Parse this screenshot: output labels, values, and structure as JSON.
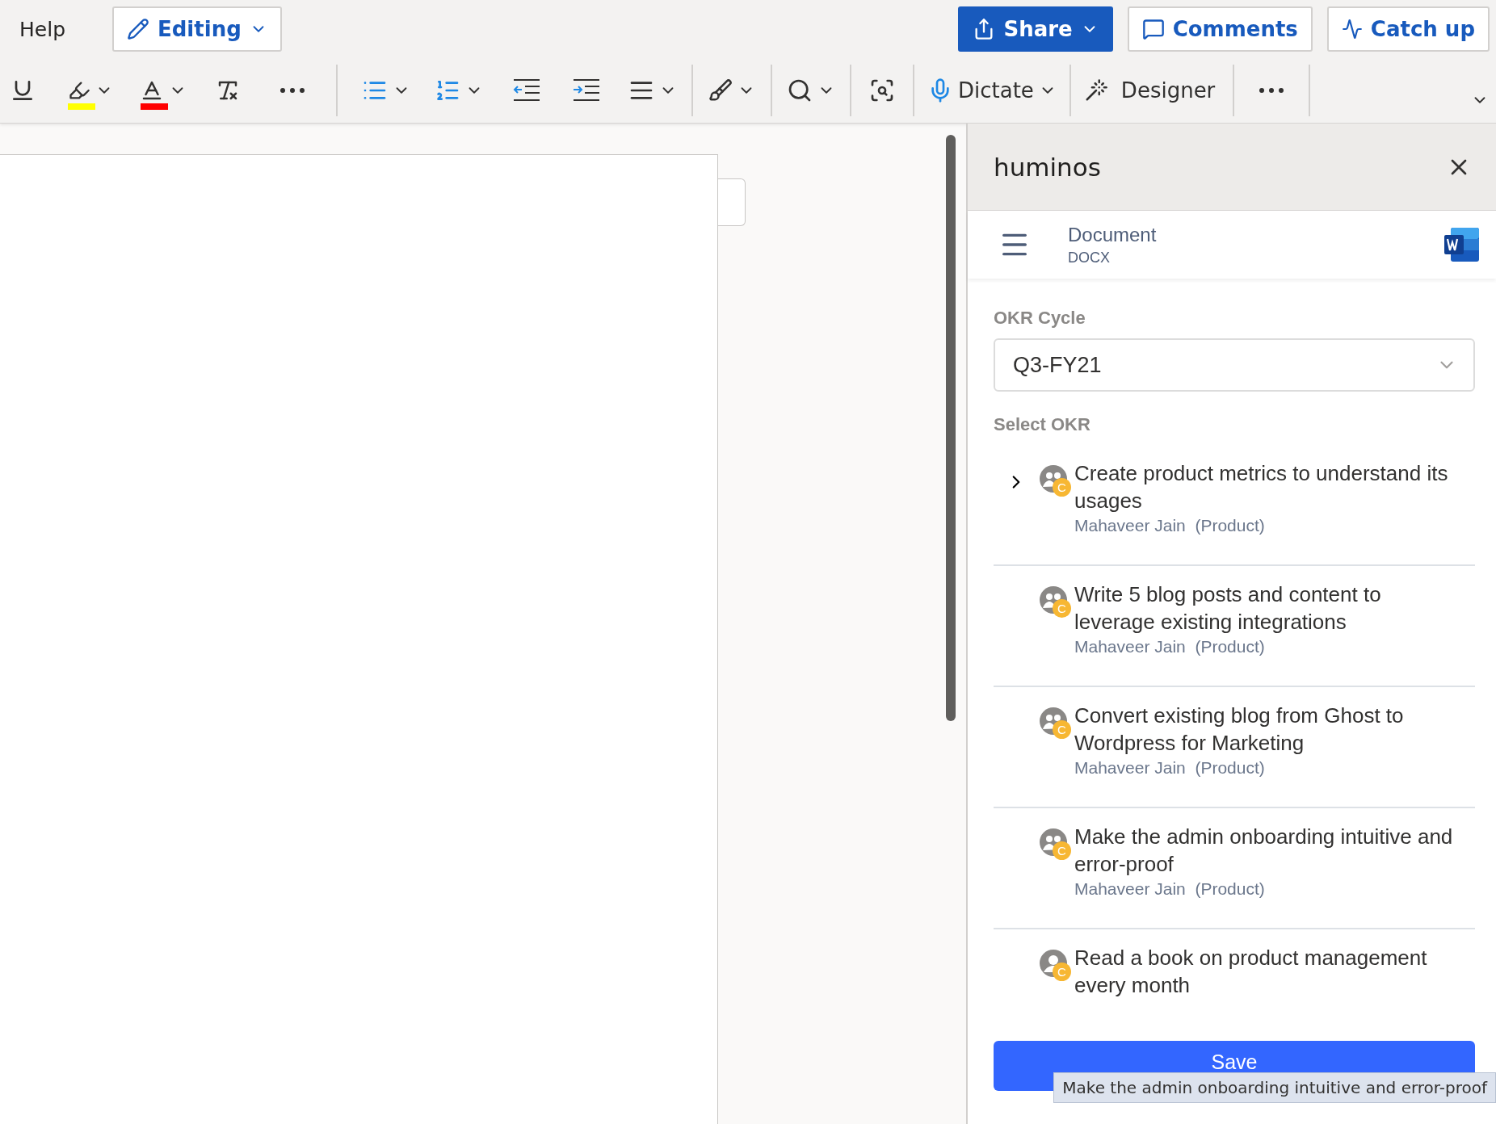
{
  "menu": {
    "help": "Help"
  },
  "mode_button": {
    "label": "Editing"
  },
  "actions": [
    {
      "kind": "share",
      "label": "Share"
    },
    {
      "kind": "comments",
      "label": "Comments"
    },
    {
      "kind": "catchup",
      "label": "Catch up"
    }
  ],
  "ribbon": {
    "dictate": "Dictate",
    "designer": "Designer"
  },
  "panel": {
    "title": "huminos",
    "document": {
      "name": "Document",
      "type": "DOCX"
    },
    "cycle": {
      "label": "OKR Cycle",
      "value": "Q3-FY21"
    },
    "select_label": "Select OKR",
    "okrs": [
      {
        "title": "Create product metrics to understand its usages",
        "owner": "Mahaveer Jain",
        "team": "(Product)",
        "expandable": true,
        "kind": "group",
        "badge": "C"
      },
      {
        "title": "Write 5 blog posts and content to leverage existing integrations",
        "owner": "Mahaveer Jain",
        "team": "(Product)",
        "expandable": false,
        "kind": "group",
        "badge": "C"
      },
      {
        "title": "Convert existing blog from Ghost to Wordpress for Marketing",
        "owner": "Mahaveer Jain",
        "team": "(Product)",
        "expandable": false,
        "kind": "group",
        "badge": "C"
      },
      {
        "title": "Make the admin onboarding intuitive and error-proof",
        "owner": "Mahaveer Jain",
        "team": "(Product)",
        "expandable": false,
        "kind": "group",
        "badge": "C"
      },
      {
        "title": "Read a book on product management every month",
        "expandable": false,
        "kind": "person",
        "badge": "C"
      }
    ],
    "save": "Save",
    "tooltip": "Make the admin onboarding intuitive and error-proof"
  }
}
